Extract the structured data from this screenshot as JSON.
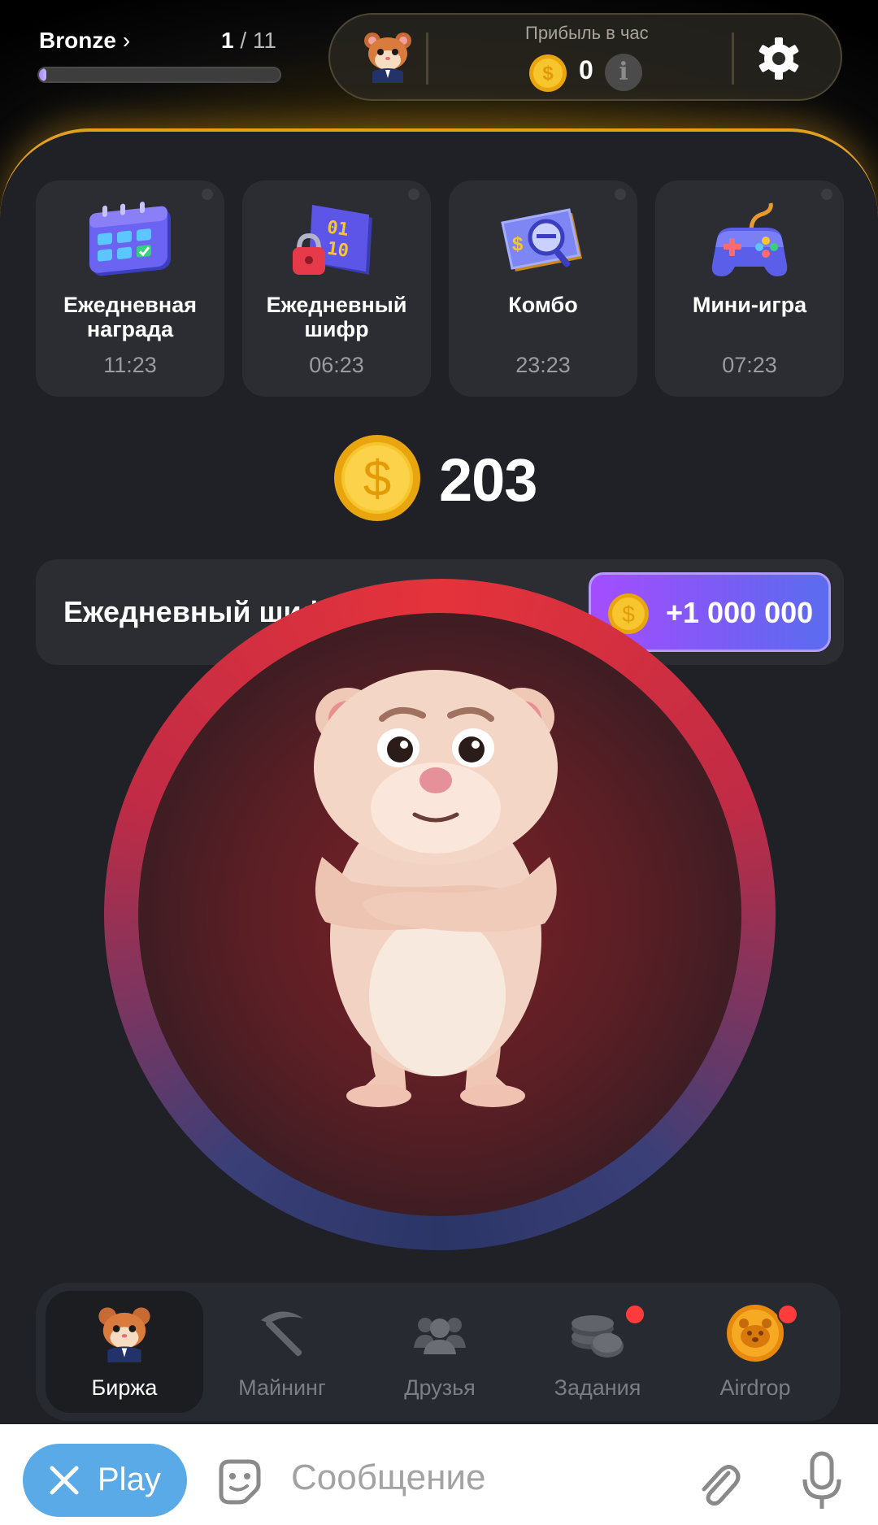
{
  "header": {
    "rank": "Bronze",
    "level_current": "1",
    "level_total": "11",
    "level_progress": 0.03,
    "profit_label": "Прибыль в час",
    "profit_value": "0"
  },
  "daily_cards": [
    {
      "title_line1": "Ежедневная",
      "title_line2": "награда",
      "timer": "11:23",
      "icon": "calendar-icon"
    },
    {
      "title_line1": "Ежедневный",
      "title_line2": "шифр",
      "timer": "06:23",
      "icon": "cipher-lock-icon"
    },
    {
      "title_line1": "Комбо",
      "title_line2": "",
      "timer": "23:23",
      "icon": "combo-card-icon"
    },
    {
      "title_line1": "Мини-игра",
      "title_line2": "",
      "timer": "07:23",
      "icon": "gamepad-icon"
    }
  ],
  "balance": "203",
  "cipher": {
    "title": "Ежедневный шифр",
    "reward": "+1 000 000"
  },
  "nav": [
    {
      "label": "Биржа",
      "active": true,
      "badge": false
    },
    {
      "label": "Майнинг",
      "active": false,
      "badge": false
    },
    {
      "label": "Друзья",
      "active": false,
      "badge": false
    },
    {
      "label": "Задания",
      "active": false,
      "badge": true
    },
    {
      "label": "Airdrop",
      "active": false,
      "badge": true
    }
  ],
  "telegram": {
    "play_label": "Play",
    "message_placeholder": "Сообщение"
  },
  "colors": {
    "accent_gold": "#e2a01f",
    "panel_bg": "#1f2126",
    "card_bg": "#2b2d33",
    "reward_gradient_start": "#a44dff",
    "reward_gradient_end": "#5b6cf0",
    "badge_red": "#ff3b3b",
    "telegram_blue": "#5aaae8"
  }
}
